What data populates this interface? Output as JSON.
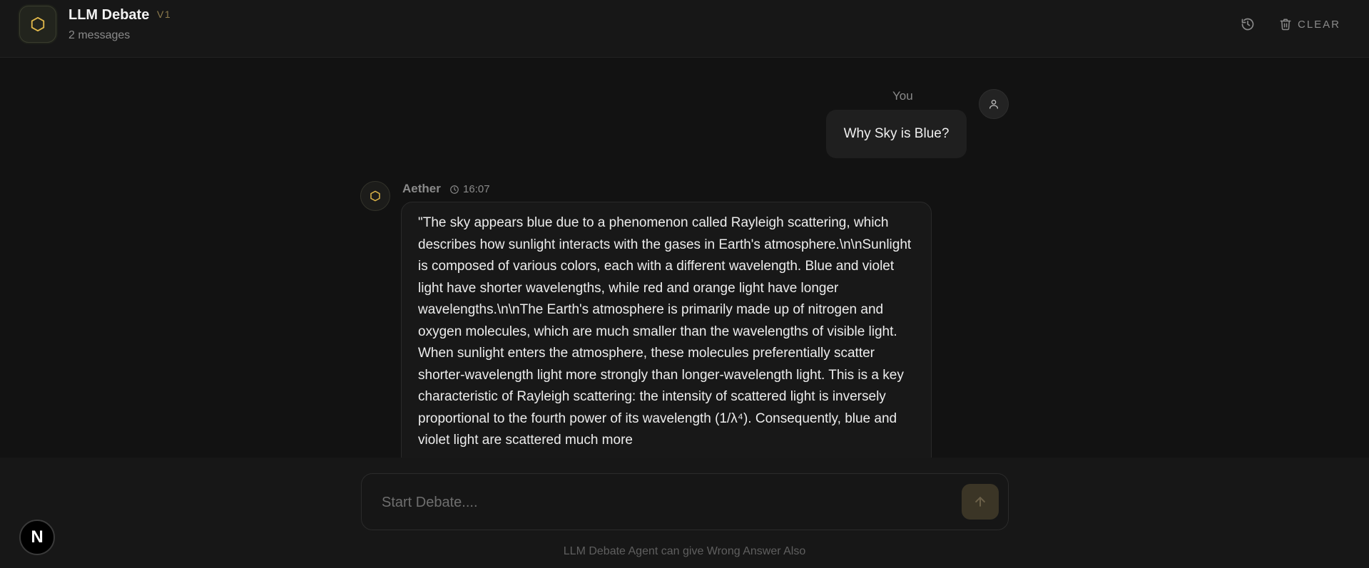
{
  "header": {
    "logo_icon": "hexagon-icon",
    "title": "LLM Debate",
    "version": "V1",
    "subtitle": "2 messages",
    "history_icon": "history-icon",
    "clear_icon": "trash-icon",
    "clear_label": "CLEAR"
  },
  "messages": {
    "user": {
      "name": "You",
      "text": "Why Sky is Blue?",
      "avatar_icon": "user-icon"
    },
    "bot": {
      "name": "Aether",
      "time": "16:07",
      "avatar_icon": "hexagon-icon",
      "text": "\"The sky appears blue due to a phenomenon called Rayleigh scattering, which describes how sunlight interacts with the gases in Earth's atmosphere.\\n\\nSunlight is composed of various colors, each with a different wavelength. Blue and violet light have shorter wavelengths, while red and orange light have longer wavelengths.\\n\\nThe Earth's atmosphere is primarily made up of nitrogen and oxygen molecules, which are much smaller than the wavelengths of visible light. When sunlight enters the atmosphere, these molecules preferentially scatter shorter-wavelength light more strongly than longer-wavelength light. This is a key characteristic of Rayleigh scattering: the intensity of scattered light is inversely proportional to the fourth power of its wavelength (1/λ⁴). Consequently, blue and violet light are scattered much more"
    }
  },
  "composer": {
    "placeholder": "Start Debate....",
    "value": "",
    "send_icon": "arrow-up-icon"
  },
  "footer": {
    "disclaimer": "LLM Debate Agent can give Wrong Answer Also",
    "badge_letter": "N"
  },
  "colors": {
    "accent": "#e0b84a",
    "background": "#141414"
  }
}
